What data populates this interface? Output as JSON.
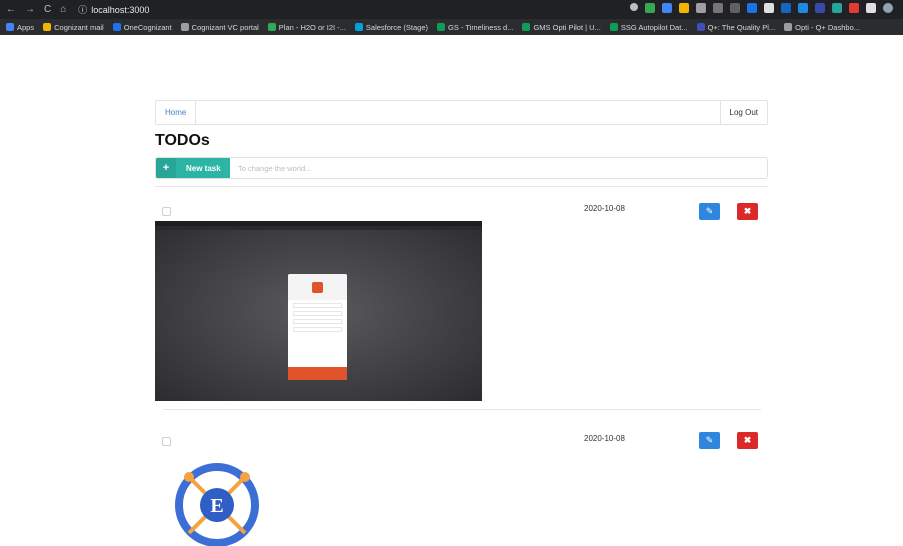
{
  "browser": {
    "url": "localhost:3000",
    "bookmarks": [
      {
        "label": "Apps",
        "color": "#4285f4"
      },
      {
        "label": "Cognizant mail",
        "color": "#f4b400"
      },
      {
        "label": "OneCognizant",
        "color": "#1a73e8"
      },
      {
        "label": "Cognizant VC portal",
        "color": "#9e9e9e"
      },
      {
        "label": "Plan - H2O or I2I -...",
        "color": "#34a853"
      },
      {
        "label": "Salesforce (Stage)",
        "color": "#00a1e0"
      },
      {
        "label": "GS - Timeliness d...",
        "color": "#0f9d58"
      },
      {
        "label": "GMS Opti Pilot | U...",
        "color": "#0f9d58"
      },
      {
        "label": "SSG Autopilot Dat...",
        "color": "#0f9d58"
      },
      {
        "label": "Q+: The Quality Pl...",
        "color": "#3f51b5"
      },
      {
        "label": "Opti - Q+ Dashbo...",
        "color": "#9e9e9e"
      }
    ]
  },
  "nav": {
    "home": "Home",
    "logout": "Log Out"
  },
  "page": {
    "title": "TODOs"
  },
  "new_task": {
    "plus": "+",
    "label": "New task",
    "placeholder": "To change the world..."
  },
  "todos": [
    {
      "date": "2020-10-08",
      "edit_icon": "pencil-icon",
      "delete_icon": "close-icon",
      "image": "screenshot-signup"
    },
    {
      "date": "2020-10-08",
      "edit_icon": "pencil-icon",
      "delete_icon": "close-icon",
      "image": "e-logo"
    }
  ],
  "colors": {
    "accent": "#2cb5a5",
    "edit": "#2e86de",
    "delete": "#db2828",
    "link": "#4183c4"
  }
}
